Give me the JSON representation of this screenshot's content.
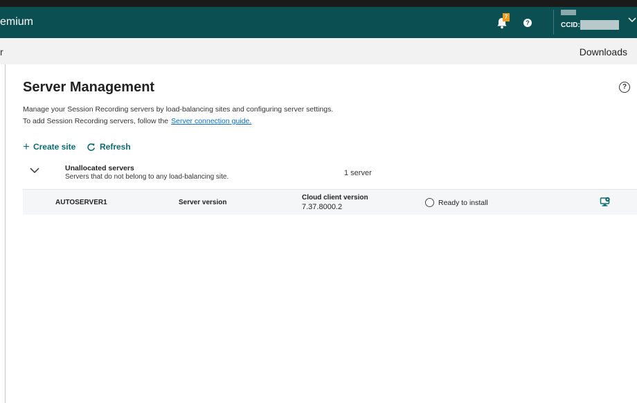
{
  "header": {
    "brand_partial": "emium",
    "notification_count": "7",
    "help_glyph": "?",
    "ccid_label": "CCID:",
    "icons": [
      "bell-icon",
      "help-icon",
      "chevron-down-icon"
    ],
    "colors": {
      "bar": "#0c4f53",
      "badge": "#f29a1e"
    }
  },
  "subbar": {
    "left_partial": "r",
    "downloads": "Downloads"
  },
  "page": {
    "title": "Server Management",
    "help_glyph": "?",
    "description_line1": "Manage your Session Recording servers by load-balancing sites and configuring server settings.",
    "description_line2": "To add Session Recording servers, follow the",
    "guide_link": "Server connection guide.",
    "actions": {
      "create_site": "Create site",
      "refresh": "Refresh"
    },
    "accent_color": "#0c6b73",
    "link_color": "#0b6cc4"
  },
  "group": {
    "title": "Unallocated servers",
    "subtitle": "Servers that do not belong to any load-balancing site.",
    "count": "1 server",
    "servers": [
      {
        "name": "AUTOSERVER1",
        "version_label": "Server version",
        "client_label": "Cloud client version",
        "client_value": "7.37.8000.2",
        "status": "Ready to install",
        "action_icon": "server-settings-icon"
      }
    ]
  }
}
